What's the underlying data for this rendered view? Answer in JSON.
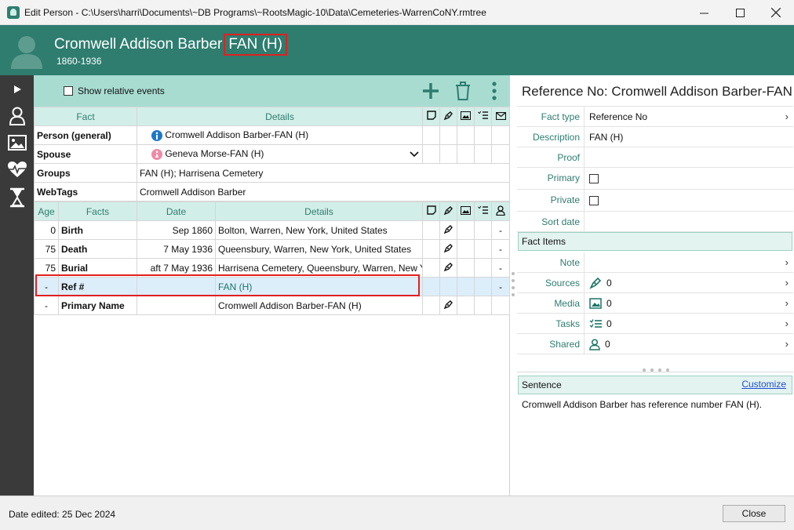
{
  "window": {
    "title": "Edit Person - C:\\Users\\harri\\Documents\\~DB Programs\\~RootsMagic-10\\Data\\Cemeteries-WarrenCoNY.rmtree",
    "minimize": "—",
    "maximize": "☐",
    "close": "✕"
  },
  "person": {
    "name": "Cromwell Addison Barber",
    "name_suffix": "FAN (H)",
    "years": "1860-1936"
  },
  "toolbar": {
    "show_relative_events": "Show relative events"
  },
  "top_table": {
    "headers": {
      "fact": "Fact",
      "details": "Details"
    },
    "rows": [
      {
        "fact": "Person (general)",
        "details": "Cromwell Addison Barber-FAN (H)"
      },
      {
        "fact": "Spouse",
        "details": "Geneva Morse-FAN (H)"
      },
      {
        "fact": "Groups",
        "details": "FAN (H); Harrisena Cemetery"
      },
      {
        "fact": "WebTags",
        "details": "Cromwell Addison Barber"
      }
    ]
  },
  "facts_table": {
    "headers": {
      "age": "Age",
      "facts": "Facts",
      "date": "Date",
      "details": "Details"
    },
    "rows": [
      {
        "age": "0",
        "fact": "Birth",
        "date": "Sep 1860",
        "details": "Bolton, Warren, New York, United States",
        "shared": "-"
      },
      {
        "age": "75",
        "fact": "Death",
        "date": "7 May 1936",
        "details": "Queensbury, Warren, New York, United States",
        "shared": "-"
      },
      {
        "age": "75",
        "fact": "Burial",
        "date": "aft 7 May 1936",
        "details": "Harrisena Cemetery, Queensbury, Warren, New York, United States",
        "shared": "-"
      },
      {
        "age": "-",
        "fact": "Ref #",
        "date": "",
        "details": "FAN (H)",
        "shared": "-"
      },
      {
        "age": "-",
        "fact": "Primary Name",
        "date": "",
        "details": "Cromwell Addison Barber-FAN (H)",
        "shared": ""
      }
    ]
  },
  "right_panel": {
    "title": "Reference No: Cromwell Addison Barber-FAN (H)",
    "fields": {
      "fact_type_label": "Fact type",
      "fact_type_value": "Reference No",
      "description_label": "Description",
      "description_value": "FAN (H)",
      "proof_label": "Proof",
      "primary_label": "Primary",
      "private_label": "Private",
      "sort_date_label": "Sort date"
    },
    "fact_items_title": "Fact Items",
    "items": {
      "note_label": "Note",
      "sources_label": "Sources",
      "sources_count": "0",
      "media_label": "Media",
      "media_count": "0",
      "tasks_label": "Tasks",
      "tasks_count": "0",
      "shared_label": "Shared",
      "shared_count": "0"
    },
    "sentence_title": "Sentence",
    "customize_link": "Customize",
    "sentence_text": "Cromwell Addison Barber has reference number FAN (H)."
  },
  "status": {
    "date_edited": "Date edited: 25 Dec 2024",
    "close_button": "Close"
  },
  "colors": {
    "header_teal": "#2e7d6f",
    "toolbar_mint": "#a8dcd1",
    "highlight_red": "#e02020",
    "selected_row": "#ddeefb"
  }
}
